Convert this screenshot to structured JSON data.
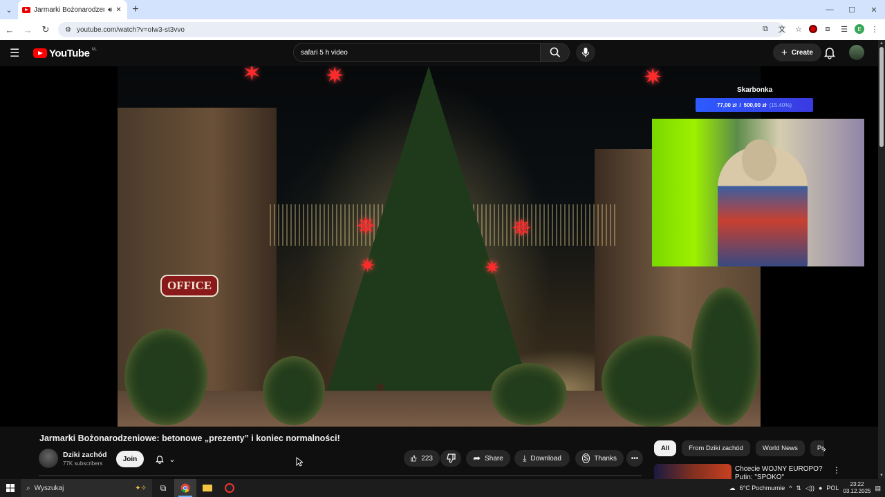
{
  "browser": {
    "tab_title": "Jarmarki Bożonarodzeniow",
    "url": "youtube.com/watch?v=oIw3-st3vvo",
    "window_controls": [
      "—",
      "☐",
      "✕"
    ]
  },
  "youtube": {
    "logo_text": "YouTube",
    "logo_country": "NL",
    "search_value": "safari 5 h video",
    "create_label": "Create"
  },
  "overlay": {
    "title": "Skarbonka",
    "current": "77,00 zł",
    "separator": "/",
    "target": "500,00 zł",
    "percent": "(15.40%)",
    "progress": 0.154
  },
  "video_sign": "OFFICE",
  "video": {
    "title": "Jarmarki Bożonarodzeniowe: betonowe „prezenty” i koniec normalności!",
    "channel_name": "Dziki zachód",
    "subscribers": "77K subscribers",
    "join_label": "Join",
    "likes": "223",
    "share_label": "Share",
    "download_label": "Download",
    "thanks_label": "Thanks"
  },
  "chips": [
    "All",
    "From Dziki zachód",
    "World News",
    "Politi"
  ],
  "recommendation": {
    "title": "Chcecie WOJNY EUROPO? Putin: \"SPOKO\""
  },
  "taskbar": {
    "search_placeholder": "Wyszukaj",
    "weather": "6°C  Pochmurnie",
    "lang": "POL",
    "time": "23:22",
    "date": "03.12.2025"
  },
  "colors": {
    "yt_red": "#ff0000",
    "overlay_blue": "#2c5bff",
    "chrome_tab_bar": "#d3e3fd"
  }
}
